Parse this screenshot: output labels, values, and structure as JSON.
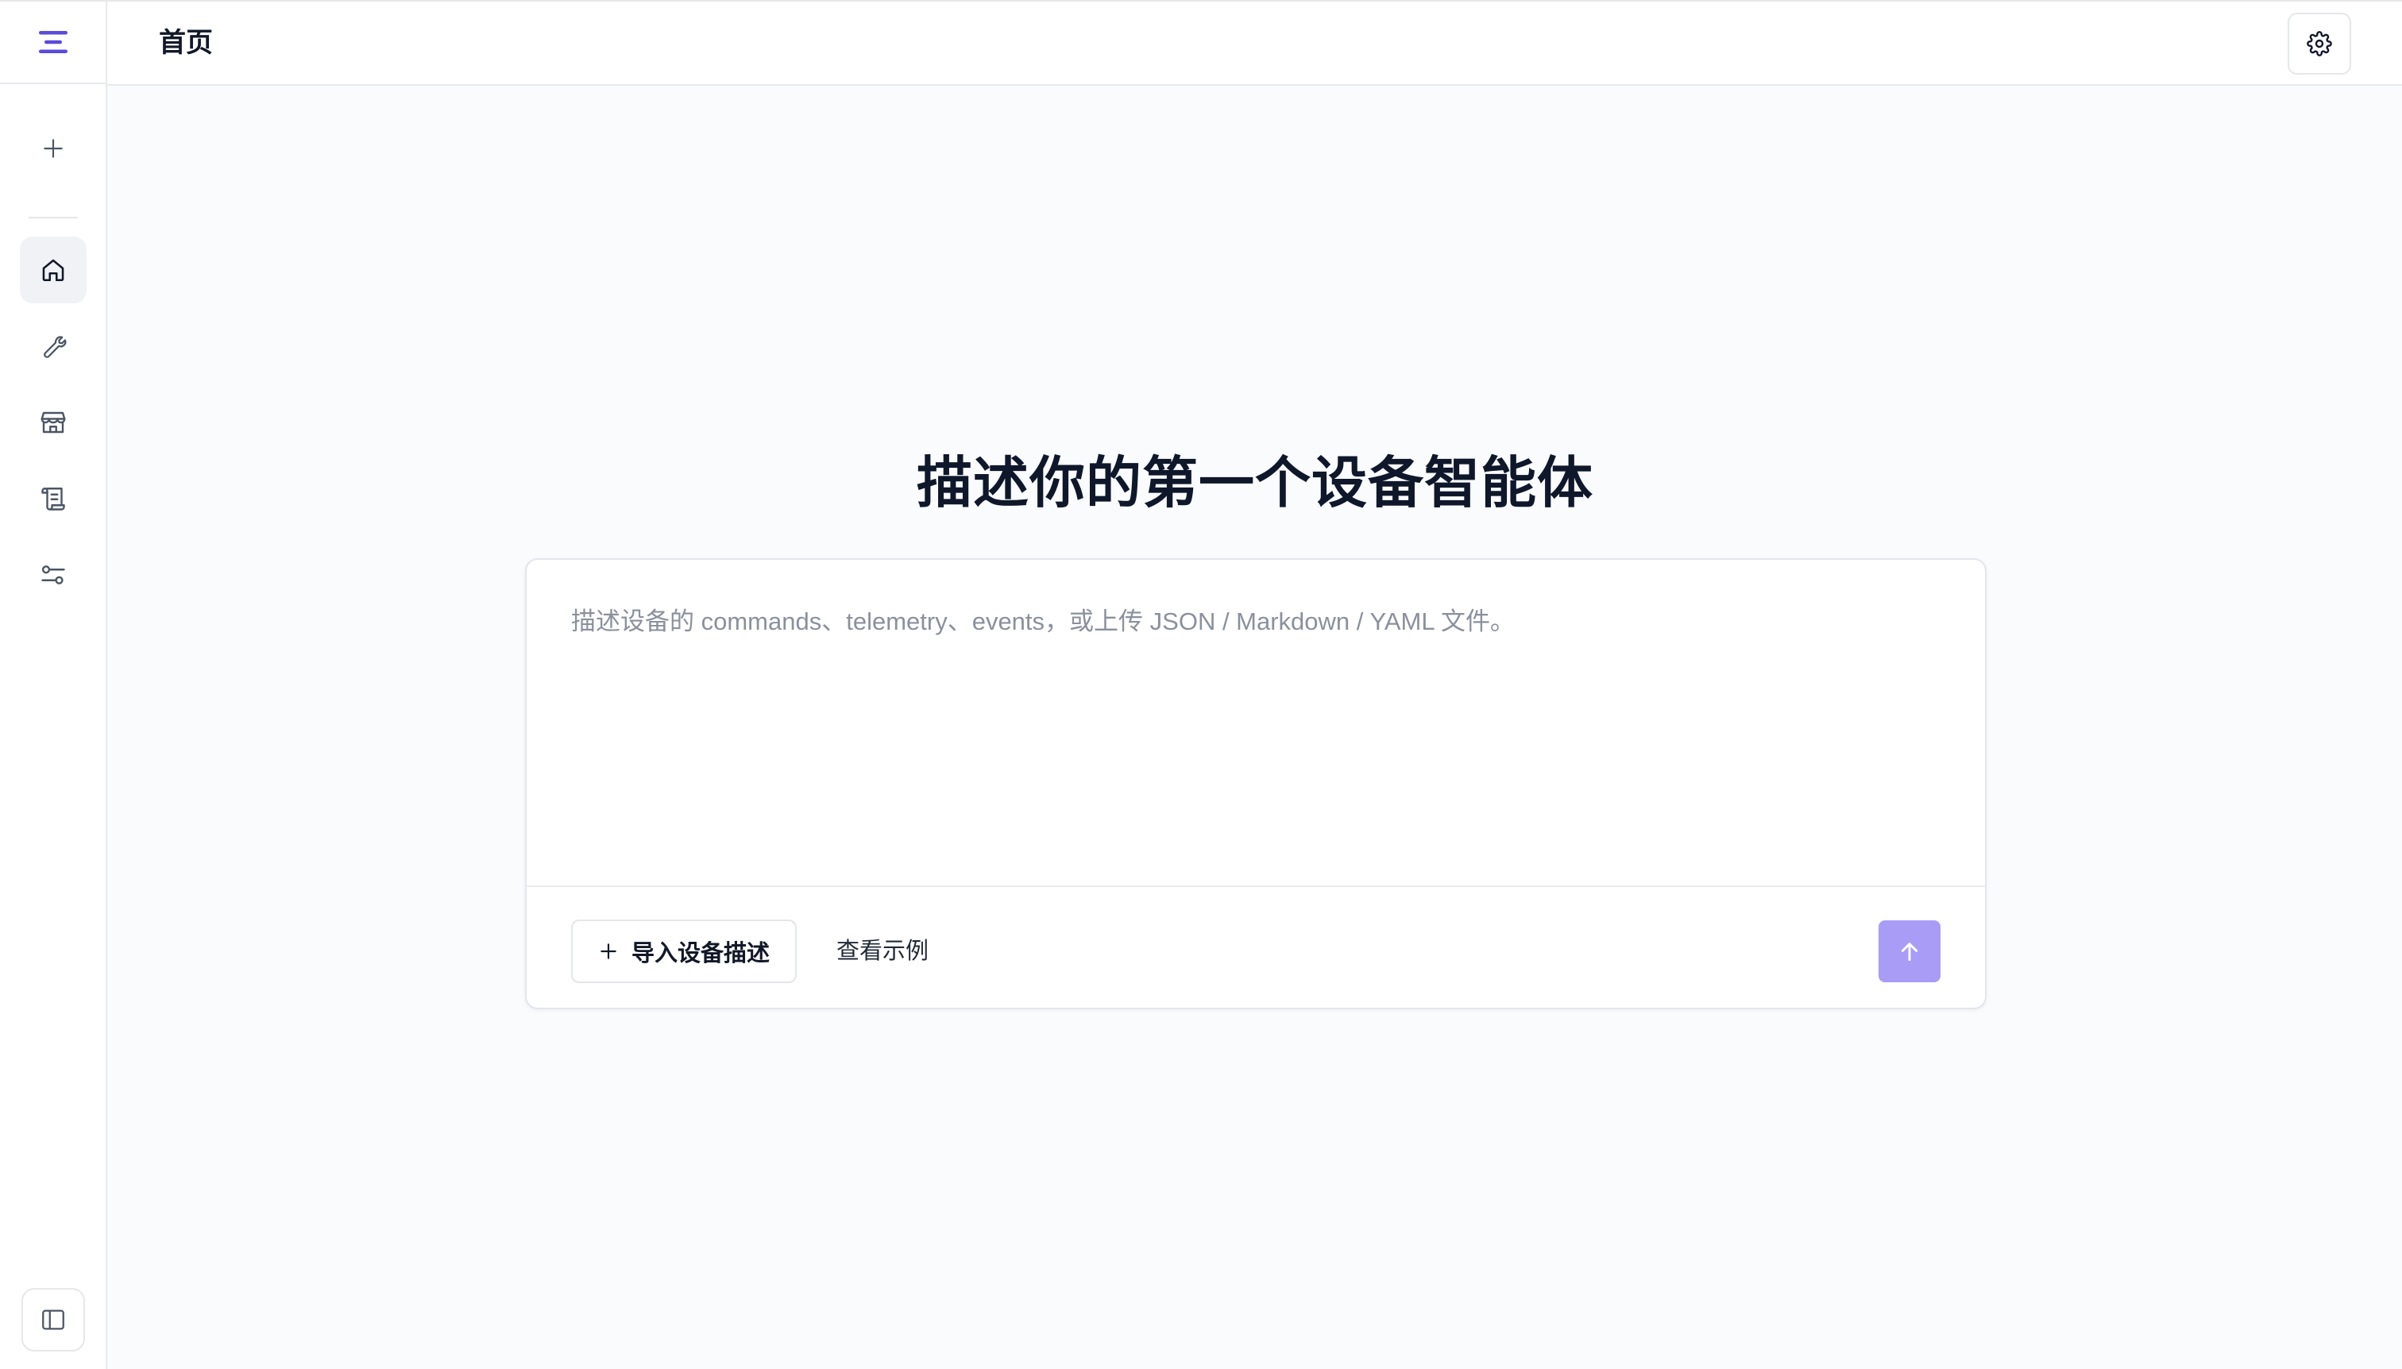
{
  "header": {
    "title": "首页"
  },
  "sidebar": {
    "items": [
      {
        "name": "new",
        "icon": "plus-icon"
      },
      {
        "name": "home",
        "icon": "home-icon",
        "active": true
      },
      {
        "name": "tools",
        "icon": "wrench-icon"
      },
      {
        "name": "store",
        "icon": "store-icon"
      },
      {
        "name": "logs",
        "icon": "scroll-icon"
      },
      {
        "name": "settings",
        "icon": "sliders-icon"
      }
    ],
    "collapse_icon": "panel-left-icon"
  },
  "main": {
    "heading": "描述你的第一个设备智能体",
    "composer": {
      "value": "",
      "placeholder": "描述设备的 commands、telemetry、events，或上传 JSON / Markdown / YAML 文件。",
      "import_label": "导入设备描述",
      "example_label": "查看示例"
    }
  },
  "colors": {
    "accent": "#5b4bdb",
    "send_button": "#a99cf6",
    "background": "#fafbfd"
  }
}
